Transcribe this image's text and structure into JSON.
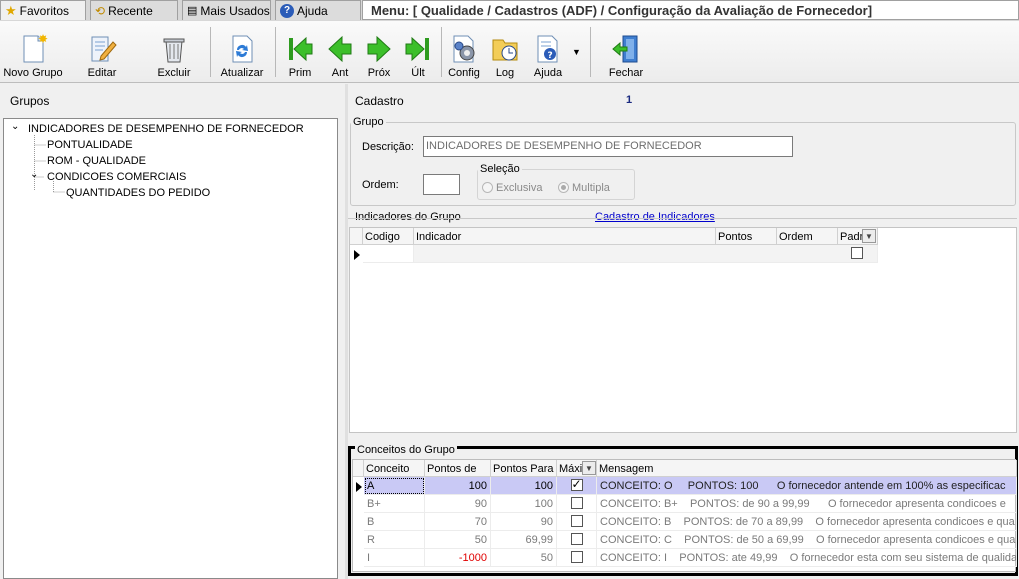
{
  "tabs": [
    {
      "label": "Favoritos",
      "icon": "star-icon"
    },
    {
      "label": "Recente",
      "icon": "recent-icon"
    },
    {
      "label": "Mais Usados",
      "icon": "most-used-icon"
    },
    {
      "label": "Ajuda",
      "icon": "help-icon"
    }
  ],
  "menu_path": "Menu: [ Qualidade / Cadastros (ADF) / Configuração da Avaliação de Fornecedor]",
  "toolbar": {
    "novo_grupo": "Novo Grupo",
    "editar": "Editar",
    "excluir": "Excluir",
    "atualizar": "Atualizar",
    "prim": "Prim",
    "ant": "Ant",
    "prox": "Próx",
    "ult": "Últ",
    "config": "Config",
    "log": "Log",
    "ajuda": "Ajuda",
    "fechar": "Fechar"
  },
  "left": {
    "title": "Grupos",
    "tree": [
      "INDICADORES DE DESEMPENHO DE FORNECEDOR",
      "PONTUALIDADE",
      "ROM - QUALIDADE",
      "CONDICOES COMERCIAIS",
      "QUANTIDADES DO PEDIDO"
    ]
  },
  "cadastro": {
    "title": "Cadastro",
    "record_number": "1",
    "group_legend": "Grupo",
    "descricao_label": "Descrição:",
    "descricao_value": "INDICADORES DE DESEMPENHO DE FORNECEDOR",
    "ordem_label": "Ordem:",
    "ordem_value": "",
    "selecao_legend": "Seleção",
    "radio_exclusiva": "Exclusiva",
    "radio_multipla": "Multipla"
  },
  "indicadores": {
    "legend": "Indicadores do Grupo",
    "link": "Cadastro de Indicadores",
    "columns": [
      "Codigo",
      "Indicador",
      "Pontos",
      "Ordem",
      "Padr"
    ]
  },
  "conceitos": {
    "legend": "Conceitos do Grupo",
    "columns": [
      "Conceito",
      "Pontos de",
      "Pontos Para",
      "Máxi",
      "Mensagem"
    ],
    "rows": [
      {
        "conceito": "A",
        "de": "100",
        "para": "100",
        "max": true,
        "msg": "CONCEITO: O     PONTOS: 100      O fornecedor antende em 100% as especificac"
      },
      {
        "conceito": "B+",
        "de": "90",
        "para": "100",
        "max": false,
        "msg": "CONCEITO: B+    PONTOS: de 90 a 99,99      O fornecedor apresenta condicoes e"
      },
      {
        "conceito": "B",
        "de": "70",
        "para": "90",
        "max": false,
        "msg": "CONCEITO: B    PONTOS: de 70 a 89,99    O fornecedor apresenta condicoes e qua"
      },
      {
        "conceito": "R",
        "de": "50",
        "para": "69,99",
        "max": false,
        "msg": "CONCEITO: C    PONTOS: de 50 a 69,99    O fornecedor apresenta condicoes e qua"
      },
      {
        "conceito": "I",
        "de": "-1000",
        "para": "50",
        "max": false,
        "msg": "CONCEITO: I    PONTOS: ate 49,99    O fornecedor esta com seu sistema de qualida"
      }
    ]
  },
  "colors": {
    "negative": "#e00000",
    "selected_row": "#c9c9f5",
    "link": "#0000cc",
    "highlight_border": "#000000"
  }
}
